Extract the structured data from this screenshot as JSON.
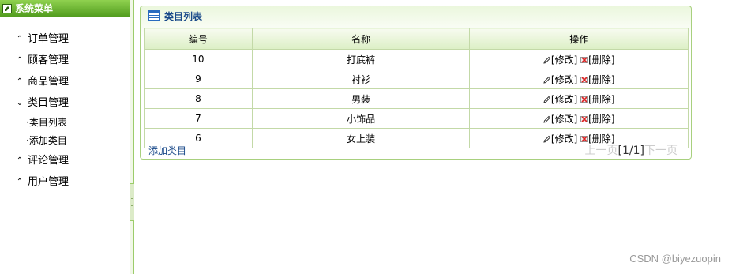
{
  "sidebar": {
    "title": "系统菜单",
    "items": [
      {
        "label": "订单管理",
        "arrow": "⌃"
      },
      {
        "label": "顾客管理",
        "arrow": "⌃"
      },
      {
        "label": "商品管理",
        "arrow": "⌃"
      },
      {
        "label": "类目管理",
        "arrow": "⌄"
      },
      {
        "label": "评论管理",
        "arrow": "⌃"
      },
      {
        "label": "用户管理",
        "arrow": "⌃"
      }
    ],
    "subitems": [
      {
        "label": "·类目列表"
      },
      {
        "label": "·添加类目"
      }
    ]
  },
  "panel": {
    "title": "类目列表",
    "columns": [
      "编号",
      "名称",
      "操作"
    ],
    "rows": [
      {
        "id": "10",
        "name": "打底裤"
      },
      {
        "id": "9",
        "name": "衬衫"
      },
      {
        "id": "8",
        "name": "男装"
      },
      {
        "id": "7",
        "name": "小饰品"
      },
      {
        "id": "6",
        "name": "女上装"
      }
    ],
    "edit_label": "[修改]",
    "delete_label": "[删除]",
    "add_label": "添加类目",
    "pager": {
      "prev": "上一页",
      "current": "[1/1]",
      "next": "下一页"
    }
  },
  "watermark": "CSDN @biyezuopin",
  "colors": {
    "accent": "#6ab42e",
    "title_blue": "#1a4a8a"
  }
}
